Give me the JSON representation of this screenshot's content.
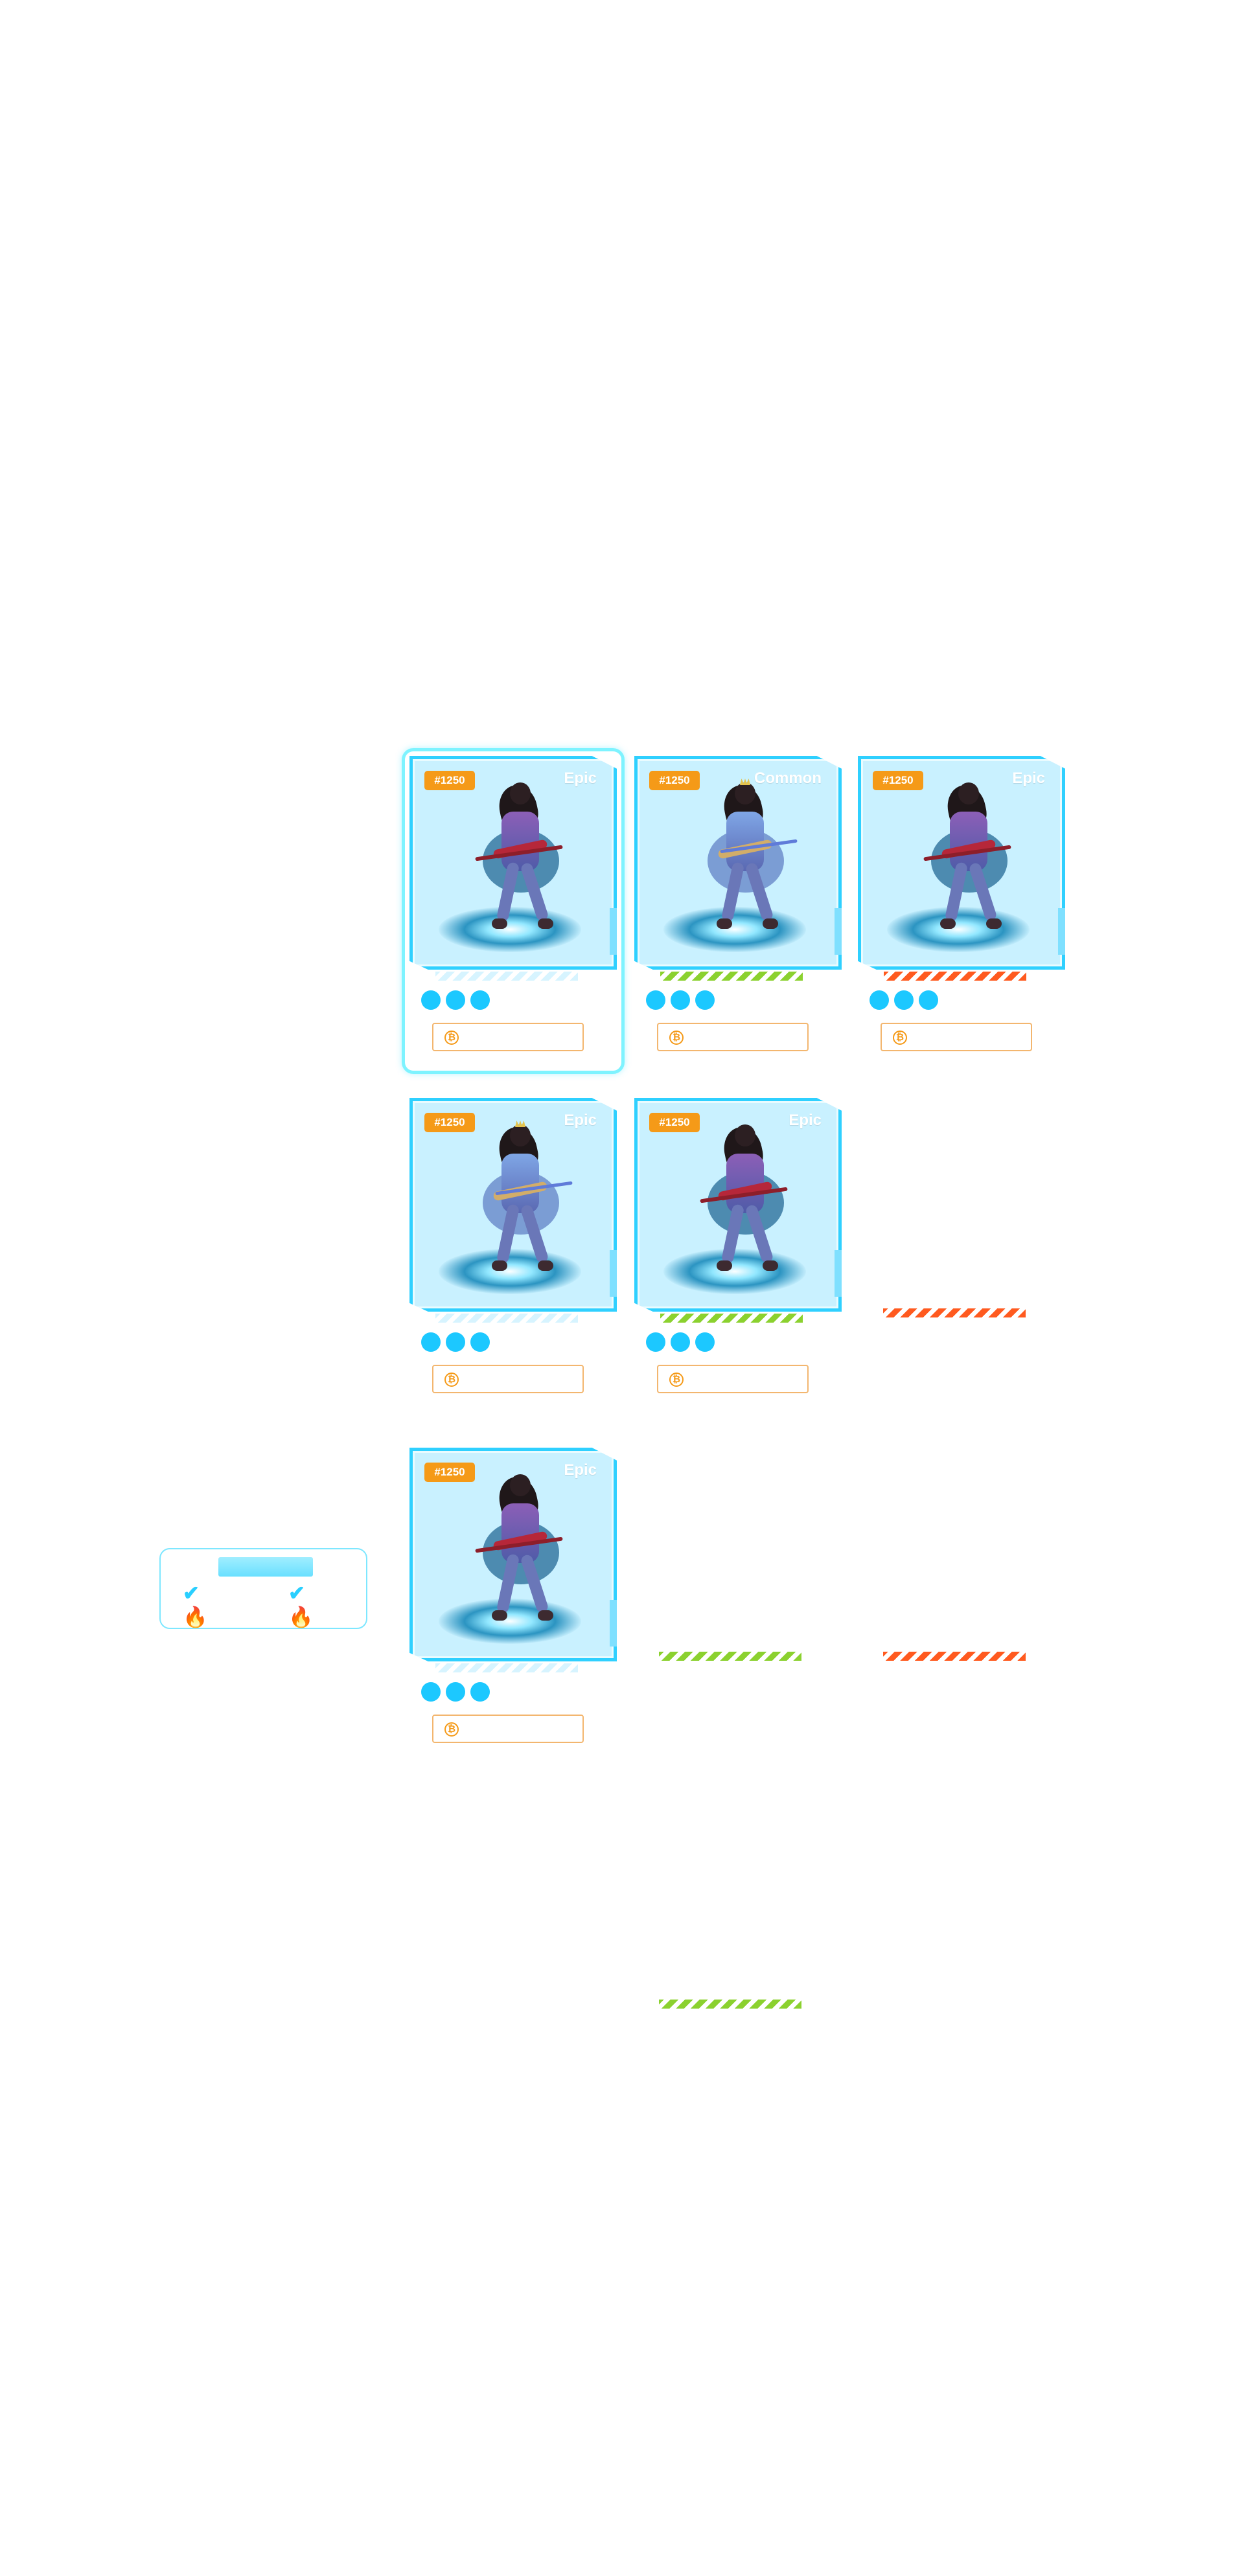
{
  "cards": [
    {
      "id": "#1250",
      "rarity": "Epic",
      "character": "warrior",
      "stripe": "#ffffff",
      "stripe_empty": true,
      "selected": true,
      "coin_icon": "bitcoin-icon",
      "dots": [
        "dot",
        "dot",
        "dot"
      ]
    },
    {
      "id": "#1250",
      "rarity": "Common",
      "character": "female",
      "stripe": "#8bd12f",
      "stripe_empty": false,
      "selected": false,
      "coin_icon": "bitcoin-icon",
      "dots": [
        "dot",
        "dot",
        "dot"
      ]
    },
    {
      "id": "#1250",
      "rarity": "Epic",
      "character": "warrior",
      "stripe": "#ff5a1f",
      "stripe_empty": false,
      "selected": false,
      "coin_icon": "bitcoin-icon",
      "dots": [
        "dot",
        "dot",
        "dot"
      ]
    },
    {
      "id": "#1250",
      "rarity": "Epic",
      "character": "female",
      "stripe": "#ffffff",
      "stripe_empty": true,
      "selected": false,
      "coin_icon": "bitcoin-icon",
      "dots": [
        "dot",
        "dot",
        "dot"
      ]
    },
    {
      "id": "#1250",
      "rarity": "Epic",
      "character": "warrior",
      "stripe": "#8bd12f",
      "stripe_empty": false,
      "selected": false,
      "coin_icon": "bitcoin-icon",
      "dots": [
        "dot",
        "dot",
        "dot"
      ]
    },
    {
      "id": "#1250",
      "rarity": "Epic",
      "character": "warrior",
      "stripe": "#ffffff",
      "stripe_empty": true,
      "selected": false,
      "coin_icon": "bitcoin-icon",
      "dots": [
        "dot",
        "dot",
        "dot"
      ]
    }
  ],
  "extra_stripes": [
    {
      "color": "#ff5a1f"
    },
    {
      "color": "#8bd12f"
    },
    {
      "color": "#ff5a1f"
    },
    {
      "color": "#8bd12f"
    }
  ],
  "filter_panel": {
    "left_icon": "checkmark-fire-icon",
    "right_icon": "checkmark-fire-icon"
  }
}
